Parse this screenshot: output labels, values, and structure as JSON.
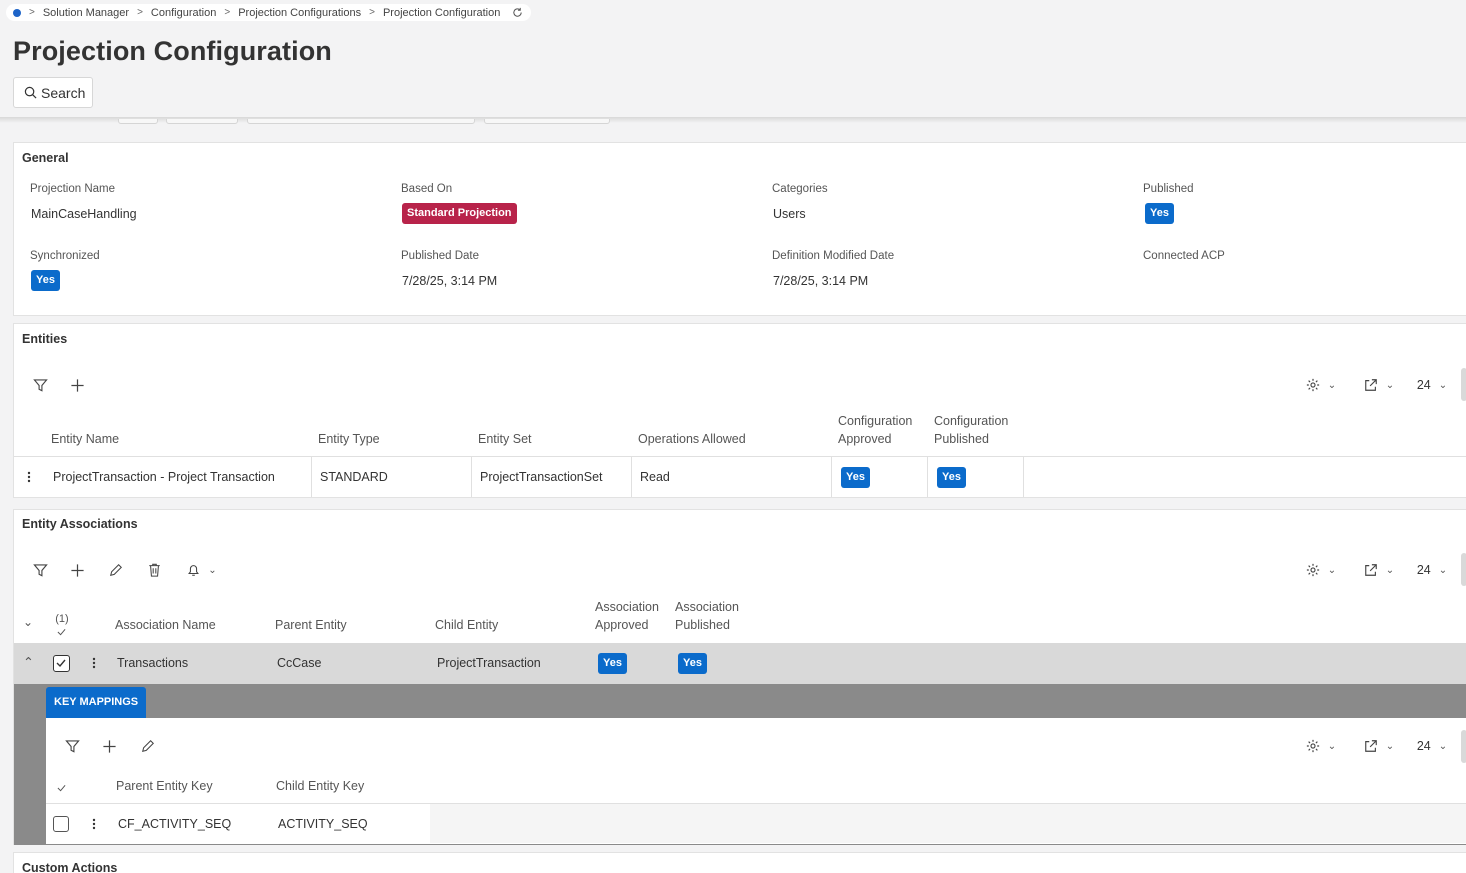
{
  "breadcrumb": {
    "items": [
      "Solution Manager",
      "Configuration",
      "Projection Configurations",
      "Projection Configuration"
    ]
  },
  "page": {
    "title": "Projection Configuration",
    "search_label": "Search"
  },
  "general": {
    "title": "General",
    "fields": [
      {
        "label": "Projection Name",
        "value": "MainCaseHandling"
      },
      {
        "label": "Based On",
        "value": "Standard Projection"
      },
      {
        "label": "Categories",
        "value": "Users"
      },
      {
        "label": "Published",
        "value": "Yes"
      },
      {
        "label": "Synchronized",
        "value": "Yes"
      },
      {
        "label": "Published Date",
        "value": "7/28/25, 3:14 PM"
      },
      {
        "label": "Definition Modified Date",
        "value": "7/28/25, 3:14 PM"
      },
      {
        "label": "Connected ACP",
        "value": ""
      }
    ]
  },
  "entities": {
    "title": "Entities",
    "page_size": "24",
    "columns": [
      "Entity Name",
      "Entity Type",
      "Entity Set",
      "Operations Allowed",
      "Configuration\nApproved",
      "Configuration\nPublished"
    ],
    "rows": [
      {
        "name": "ProjectTransaction - Project Transaction",
        "type": "STANDARD",
        "set": "ProjectTransactionSet",
        "ops": "Read",
        "approved": "Yes",
        "published": "Yes"
      }
    ]
  },
  "associations": {
    "title": "Entity Associations",
    "page_size": "24",
    "selected_count": "(1)",
    "columns": [
      "Association Name",
      "Parent Entity",
      "Child Entity",
      "Association\nApproved",
      "Association\nPublished"
    ],
    "rows": [
      {
        "name": "Transactions",
        "parent": "CcCase",
        "child": "ProjectTransaction",
        "approved": "Yes",
        "published": "Yes"
      }
    ]
  },
  "key_mappings": {
    "tab": "KEY MAPPINGS",
    "page_size": "24",
    "columns": [
      "Parent Entity Key",
      "Child Entity Key"
    ],
    "rows": [
      {
        "parent": "CF_ACTIVITY_SEQ",
        "child": "ACTIVITY_SEQ"
      }
    ]
  },
  "custom_actions": {
    "title": "Custom Actions"
  },
  "colors": {
    "accent": "#0b6bcb",
    "badge_standard": "#b8234a",
    "selected_row": "#d9d9d9",
    "detail_bg": "#8a8a8a"
  }
}
